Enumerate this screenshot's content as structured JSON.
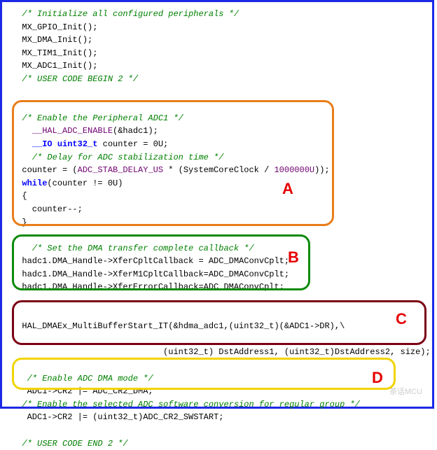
{
  "comments": {
    "init_periph": "/* Initialize all configured peripherals */",
    "user_code_begin": "/* USER CODE BEGIN 2 */",
    "enable_periph": "/* Enable the Peripheral ADC1 */",
    "delay_stab": "/* Delay for ADC stabilization time */",
    "set_dma_cb": "/* Set the DMA transfer complete callback */",
    "enable_adc_dma": "/* Enable ADC DMA mode */",
    "enable_sw_conv": "/* Enable the selected ADC software conversion for regular group */",
    "user_code_end": "/* USER CODE END 2 */"
  },
  "init_calls": [
    "MX_GPIO_Init();",
    "MX_DMA_Init();",
    "MX_TIM1_Init();",
    "MX_ADC1_Init();"
  ],
  "block_a": {
    "enable_macro": "__HAL_ADC_ENABLE",
    "enable_arg": "(&hadc1);",
    "decl_prefix": "__IO uint32_t",
    "decl_rest": " counter = 0U;",
    "counter_assign_pre": "counter = (",
    "stab_macro": "ADC_STAB_DELAY_US",
    "counter_assign_mid": " * (SystemCoreClock / ",
    "million": "1000000U",
    "counter_assign_post": "));",
    "while_kw": "while",
    "while_cond": "(counter != 0U)",
    "brace_open": "{",
    "counter_dec": "  counter--;",
    "brace_close": "}"
  },
  "block_b": {
    "l1": "hadc1.DMA_Handle->XferCpltCallback = ADC_DMAConvCplt;",
    "l2": "hadc1.DMA_Handle->XferM1CpltCallback=ADC_DMAConvCplt;",
    "l3": "hadc1.DMA_Handle->XferErrorCallback=ADC_DMAConvCplt;"
  },
  "block_c": {
    "call_l1": "HAL_DMAEx_MultiBufferStart_IT(&hdma_adc1,(uint32_t)(&ADC1->DR),\\",
    "call_l2": "                              (uint32_t) DstAddress1, (uint32_t)DstAddress2, size);"
  },
  "block_d": {
    "l1": " ADC1->CR2 |= ADC_CR2_DMA;",
    "l2": " ADC1->CR2 |= (uint32_t)ADC_CR2_SWSTART;"
  },
  "letters": {
    "a": "A",
    "b": "B",
    "c": "C",
    "d": "D"
  },
  "watermark": "茶话MCU"
}
